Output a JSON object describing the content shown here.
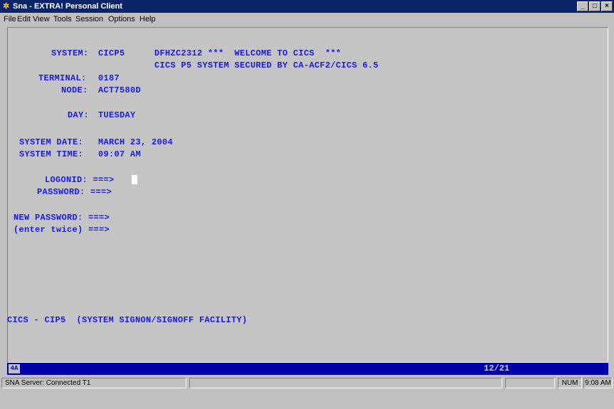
{
  "window": {
    "title": "Sna - EXTRA! Personal Client"
  },
  "menu": [
    "File",
    "Edit",
    "View",
    "Tools",
    "Session",
    "Options",
    "Help"
  ],
  "screen": {
    "system_label": "SYSTEM:",
    "system_value": "CICP5",
    "welcome": "DFHZC2312 ***  WELCOME TO CICS  ***",
    "secured": "CICS P5 SYSTEM SECURED BY CA-ACF2/CICS 6.5",
    "terminal_label": "TERMINAL:",
    "terminal_value": "0187",
    "node_label": "NODE:",
    "node_value": "ACT7580D",
    "day_label": "DAY:",
    "day_value": "TUESDAY",
    "sysdate_label": "SYSTEM DATE:",
    "sysdate_value": "MARCH 23, 2004",
    "systime_label": "SYSTEM TIME:",
    "systime_value": "09:07 AM",
    "logonid_label": "LOGONID: ===>",
    "password_label": "PASSWORD: ===>",
    "newpass_label": "NEW PASSWORD: ===>",
    "twice_label": "(enter twice) ===>",
    "footer": "CICS - CIP5  (SYSTEM SIGNON/SIGNOFF FACILITY)"
  },
  "oia": {
    "marker": "4A",
    "cursor_position": "12/21"
  },
  "statusbar": {
    "connection": "SNA Server: Connected T1",
    "num": "NUM",
    "time": "9:08 AM"
  }
}
